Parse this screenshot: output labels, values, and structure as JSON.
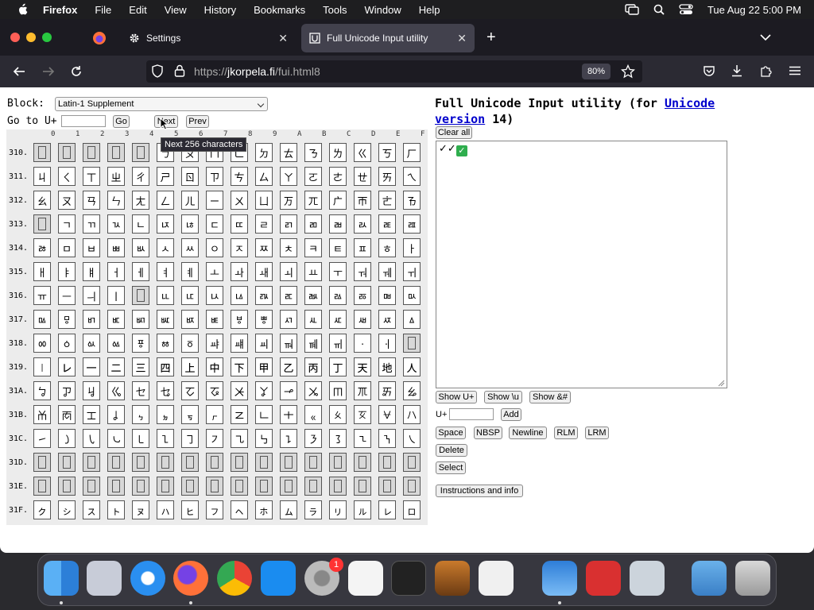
{
  "menubar": {
    "app_name": "Firefox",
    "items": [
      "File",
      "Edit",
      "View",
      "History",
      "Bookmarks",
      "Tools",
      "Window",
      "Help"
    ],
    "clock": "Tue Aug 22  5:00 PM"
  },
  "tabs": [
    {
      "label": "Settings",
      "icon": "gear-icon"
    },
    {
      "label": "Full Unicode Input utility",
      "icon": "site-favicon",
      "active": true
    }
  ],
  "navbar": {
    "url_prefix": "https://",
    "url_host": "jkorpela.fi",
    "url_path": "/fui.html8",
    "zoom": "80%"
  },
  "page": {
    "block_label": "Block:",
    "block_selected": "Latin-1 Supplement",
    "goto_label": "Go to U+",
    "goto_button": "Go",
    "next_button": "Next",
    "prev_button": "Prev",
    "tooltip": "Next 256 characters",
    "title_prefix": "Full Unicode Input utility (for ",
    "title_link": "Unicode version",
    "title_suffix": " 14)",
    "clear_all": "Clear all",
    "textarea_value": "✓✓",
    "show_uplus": "Show U+",
    "show_u": "Show \\u",
    "show_amp": "Show &#",
    "uplus_label": "U+",
    "add_button": "Add",
    "space_button": "Space",
    "nbsp_button": "NBSP",
    "newline_button": "Newline",
    "rlm_button": "RLM",
    "lrm_button": "LRM",
    "delete_button": "Delete",
    "select_button": "Select",
    "instructions_button": "Instructions and info"
  },
  "grid": {
    "col_header": [
      "0",
      "1",
      "2",
      "3",
      "4",
      "5",
      "6",
      "7",
      "8",
      "9",
      "A",
      "B",
      "C",
      "D",
      "E",
      "F"
    ],
    "rows": [
      {
        "label": "310.",
        "cells": [
          "",
          "",
          "",
          "",
          "",
          "ㄅ",
          "ㄆ",
          "ㄇ",
          "ㄈ",
          "ㄉ",
          "ㄊ",
          "ㄋ",
          "ㄌ",
          "ㄍ",
          "ㄎ",
          "ㄏ"
        ]
      },
      {
        "label": "311.",
        "cells": [
          "ㄐ",
          "ㄑ",
          "ㄒ",
          "ㄓ",
          "ㄔ",
          "ㄕ",
          "ㄖ",
          "ㄗ",
          "ㄘ",
          "ㄙ",
          "ㄚ",
          "ㄛ",
          "ㄜ",
          "ㄝ",
          "ㄞ",
          "ㄟ"
        ]
      },
      {
        "label": "312.",
        "cells": [
          "ㄠ",
          "ㄡ",
          "ㄢ",
          "ㄣ",
          "ㄤ",
          "ㄥ",
          "ㄦ",
          "ㄧ",
          "ㄨ",
          "ㄩ",
          "ㄪ",
          "ㄫ",
          "ㄬ",
          "ㄭ",
          "ㄮ",
          "ㄯ"
        ]
      },
      {
        "label": "313.",
        "cells": [
          "",
          "ㄱ",
          "ㄲ",
          "ㄳ",
          "ㄴ",
          "ㄵ",
          "ㄶ",
          "ㄷ",
          "ㄸ",
          "ㄹ",
          "ㄺ",
          "ㄻ",
          "ㄼ",
          "ㄽ",
          "ㄾ",
          "ㄿ"
        ]
      },
      {
        "label": "314.",
        "cells": [
          "ㅀ",
          "ㅁ",
          "ㅂ",
          "ㅃ",
          "ㅄ",
          "ㅅ",
          "ㅆ",
          "ㅇ",
          "ㅈ",
          "ㅉ",
          "ㅊ",
          "ㅋ",
          "ㅌ",
          "ㅍ",
          "ㅎ",
          "ㅏ"
        ]
      },
      {
        "label": "315.",
        "cells": [
          "ㅐ",
          "ㅑ",
          "ㅒ",
          "ㅓ",
          "ㅔ",
          "ㅕ",
          "ㅖ",
          "ㅗ",
          "ㅘ",
          "ㅙ",
          "ㅚ",
          "ㅛ",
          "ㅜ",
          "ㅝ",
          "ㅞ",
          "ㅟ"
        ]
      },
      {
        "label": "316.",
        "cells": [
          "ㅠ",
          "ㅡ",
          "ㅢ",
          "ㅣ",
          "",
          "ㅥ",
          "ㅦ",
          "ㅧ",
          "ㅨ",
          "ㅩ",
          "ㅪ",
          "ㅫ",
          "ㅬ",
          "ㅭ",
          "ㅮ",
          "ㅯ"
        ]
      },
      {
        "label": "317.",
        "cells": [
          "ㅰ",
          "ㅱ",
          "ㅲ",
          "ㅳ",
          "ㅴ",
          "ㅵ",
          "ㅶ",
          "ㅷ",
          "ㅸ",
          "ㅹ",
          "ㅺ",
          "ㅻ",
          "ㅼ",
          "ㅽ",
          "ㅾ",
          "ㅿ"
        ]
      },
      {
        "label": "318.",
        "cells": [
          "ㆀ",
          "ㆁ",
          "ㆂ",
          "ㆃ",
          "ㆄ",
          "ㆅ",
          "ㆆ",
          "ㆇ",
          "ㆈ",
          "ㆉ",
          "ㆊ",
          "ㆋ",
          "ㆌ",
          "ㆍ",
          "ㆎ",
          ""
        ]
      },
      {
        "label": "319.",
        "cells": [
          "㆐",
          "㆑",
          "㆒",
          "㆓",
          "㆔",
          "㆕",
          "㆖",
          "㆗",
          "㆘",
          "㆙",
          "㆚",
          "㆛",
          "㆜",
          "㆝",
          "㆞",
          "㆟"
        ]
      },
      {
        "label": "31A.",
        "cells": [
          "ㆠ",
          "ㆡ",
          "ㆢ",
          "ㆣ",
          "ㆤ",
          "ㆥ",
          "ㆦ",
          "ㆧ",
          "ㆨ",
          "ㆩ",
          "ㆪ",
          "ㆫ",
          "ㆬ",
          "ㆭ",
          "ㆮ",
          "ㆯ"
        ]
      },
      {
        "label": "31B.",
        "cells": [
          "ㆰ",
          "ㆱ",
          "ㆲ",
          "ㆳ",
          "ㆴ",
          "ㆵ",
          "ㆶ",
          "ㆷ",
          "ㆸ",
          "ㆹ",
          "ㆺ",
          "ㆻ",
          "ㆼ",
          "ㆽ",
          "ㆾ",
          "ㆿ"
        ]
      },
      {
        "label": "31C.",
        "cells": [
          "㇀",
          "㇁",
          "㇂",
          "㇃",
          "㇄",
          "㇅",
          "㇆",
          "㇇",
          "㇈",
          "㇉",
          "㇊",
          "㇋",
          "㇌",
          "㇍",
          "㇎",
          "㇏"
        ]
      },
      {
        "label": "31D.",
        "cells": [
          "",
          "",
          "",
          "",
          "",
          "",
          "",
          "",
          "",
          "",
          "",
          "",
          "",
          "",
          "",
          ""
        ]
      },
      {
        "label": "31E.",
        "cells": [
          "",
          "",
          "",
          "",
          "",
          "",
          "",
          "",
          "",
          "",
          "",
          "",
          "",
          "",
          "",
          ""
        ]
      },
      {
        "label": "31F.",
        "cells": [
          "ㇰ",
          "ㇱ",
          "ㇲ",
          "ㇳ",
          "ㇴ",
          "ㇵ",
          "ㇶ",
          "ㇷ",
          "ㇸ",
          "ㇹ",
          "ㇺ",
          "ㇻ",
          "ㇼ",
          "ㇽ",
          "ㇾ",
          "ㇿ"
        ]
      }
    ]
  },
  "dock": {
    "apps": [
      "finder-icon",
      "launchpad-icon",
      "safari-icon",
      "firefox-icon",
      "chrome-icon",
      "app-store-icon",
      "system-settings-icon",
      "textedit-icon",
      "terminal-icon",
      "garageband-icon",
      "vscode-icon",
      "weather-icon",
      "photo-booth-icon",
      "font-book-icon",
      "folder-icon",
      "trash-icon"
    ],
    "settings_badge": "1"
  },
  "colors": {
    "accent_link": "#0000cc",
    "check_green": "#2fae4e"
  }
}
